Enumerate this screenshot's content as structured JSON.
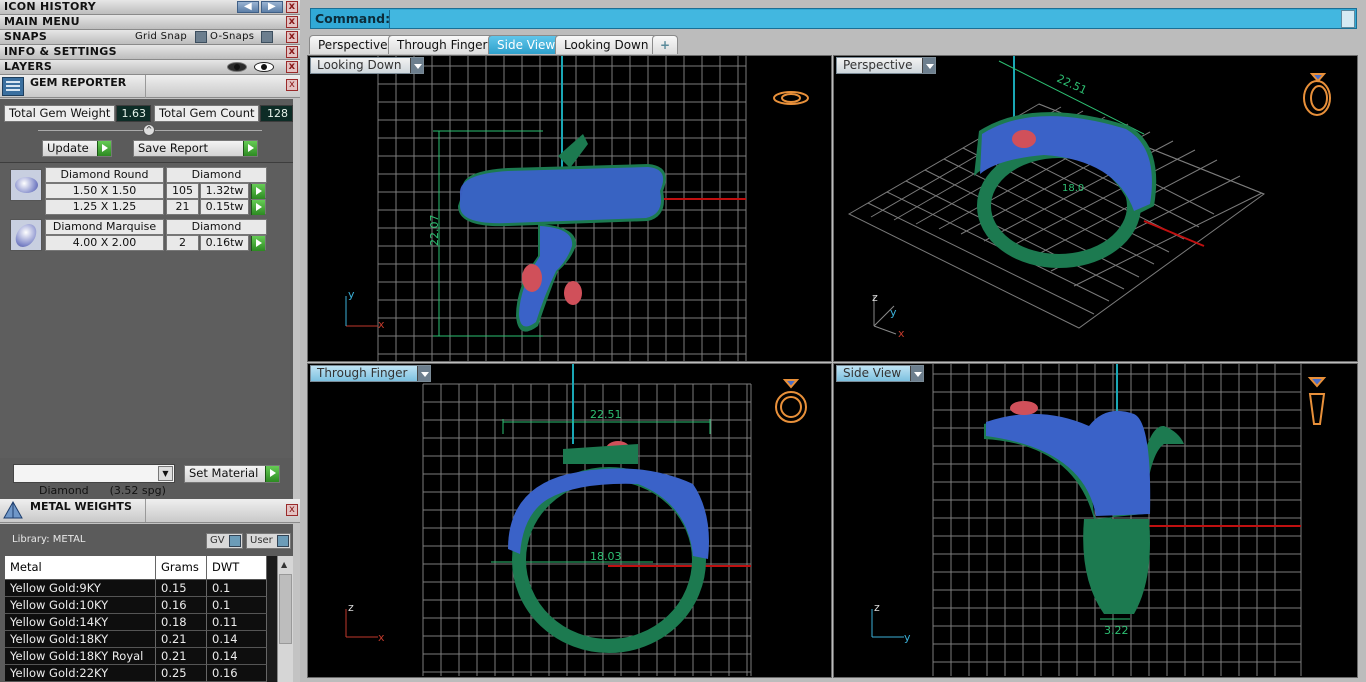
{
  "panels": {
    "icon_history": "ICON HISTORY",
    "main_menu": "MAIN MENU",
    "snaps": "SNAPS",
    "grid_snap": "Grid Snap",
    "o_snaps": "O-Snaps",
    "info_settings": "INFO & SETTINGS",
    "layers": "LAYERS",
    "close": "x"
  },
  "gem_reporter": {
    "title": "GEM REPORTER",
    "total_weight_label": "Total Gem Weight",
    "total_weight": "1.63",
    "total_count_label": "Total Gem Count",
    "total_count": "128",
    "update_label": "Update",
    "save_report_label": "Save Report",
    "groups": [
      {
        "name": "Diamond Round",
        "material": "Diamond",
        "rows": [
          {
            "size": "1.50 X 1.50",
            "count": "105",
            "weight": "1.32tw"
          },
          {
            "size": "1.25 X 1.25",
            "count": "21",
            "weight": "0.15tw"
          }
        ]
      },
      {
        "name": "Diamond Marquise",
        "material": "Diamond",
        "rows": [
          {
            "size": "4.00 X 2.00",
            "count": "2",
            "weight": "0.16tw"
          }
        ]
      }
    ],
    "material_select": "Diamond      (3.52 spg)",
    "set_material_label": "Set Material"
  },
  "metal_weights": {
    "title": "METAL WEIGHTS",
    "library_label": "Library: METAL",
    "gv_label": "GV",
    "user_label": "User",
    "columns": [
      "Metal",
      "Grams",
      "DWT"
    ],
    "rows": [
      [
        "Yellow Gold:9KY",
        "0.15",
        "0.1"
      ],
      [
        "Yellow Gold:10KY",
        "0.16",
        "0.1"
      ],
      [
        "Yellow Gold:14KY",
        "0.18",
        "0.11"
      ],
      [
        "Yellow Gold:18KY",
        "0.21",
        "0.14"
      ],
      [
        "Yellow Gold:18KY Royal",
        "0.21",
        "0.14"
      ],
      [
        "Yellow Gold:22KY",
        "0.25",
        "0.16"
      ]
    ]
  },
  "command": {
    "label": "Command:",
    "value": ""
  },
  "tabs": [
    "Perspective",
    "Through Finger",
    "Side View",
    "Looking Down"
  ],
  "active_tab": "Side View",
  "add_tab": "+",
  "viewports": {
    "top_left": {
      "title": "Looking Down",
      "dim": "22.07",
      "axis_v": "y",
      "axis_h": "x"
    },
    "top_right": {
      "title": "Perspective",
      "dim": "22.51",
      "dim2": "18.0",
      "axis_z": "z",
      "axis_y": "y",
      "axis_x": "x"
    },
    "bottom_left": {
      "title": "Through Finger",
      "dim": "22.51",
      "dim2": "18.03",
      "axis_v": "z",
      "axis_h": "x"
    },
    "bottom_right": {
      "title": "Side View",
      "dim": "3.22",
      "axis_v": "z",
      "axis_h": "y"
    }
  },
  "colors": {
    "accent": "#31a9d6",
    "metal": "#1f8a5a",
    "gem": "#3a62c8",
    "ruby": "#d0505a",
    "grid": "#8a8a8a"
  }
}
